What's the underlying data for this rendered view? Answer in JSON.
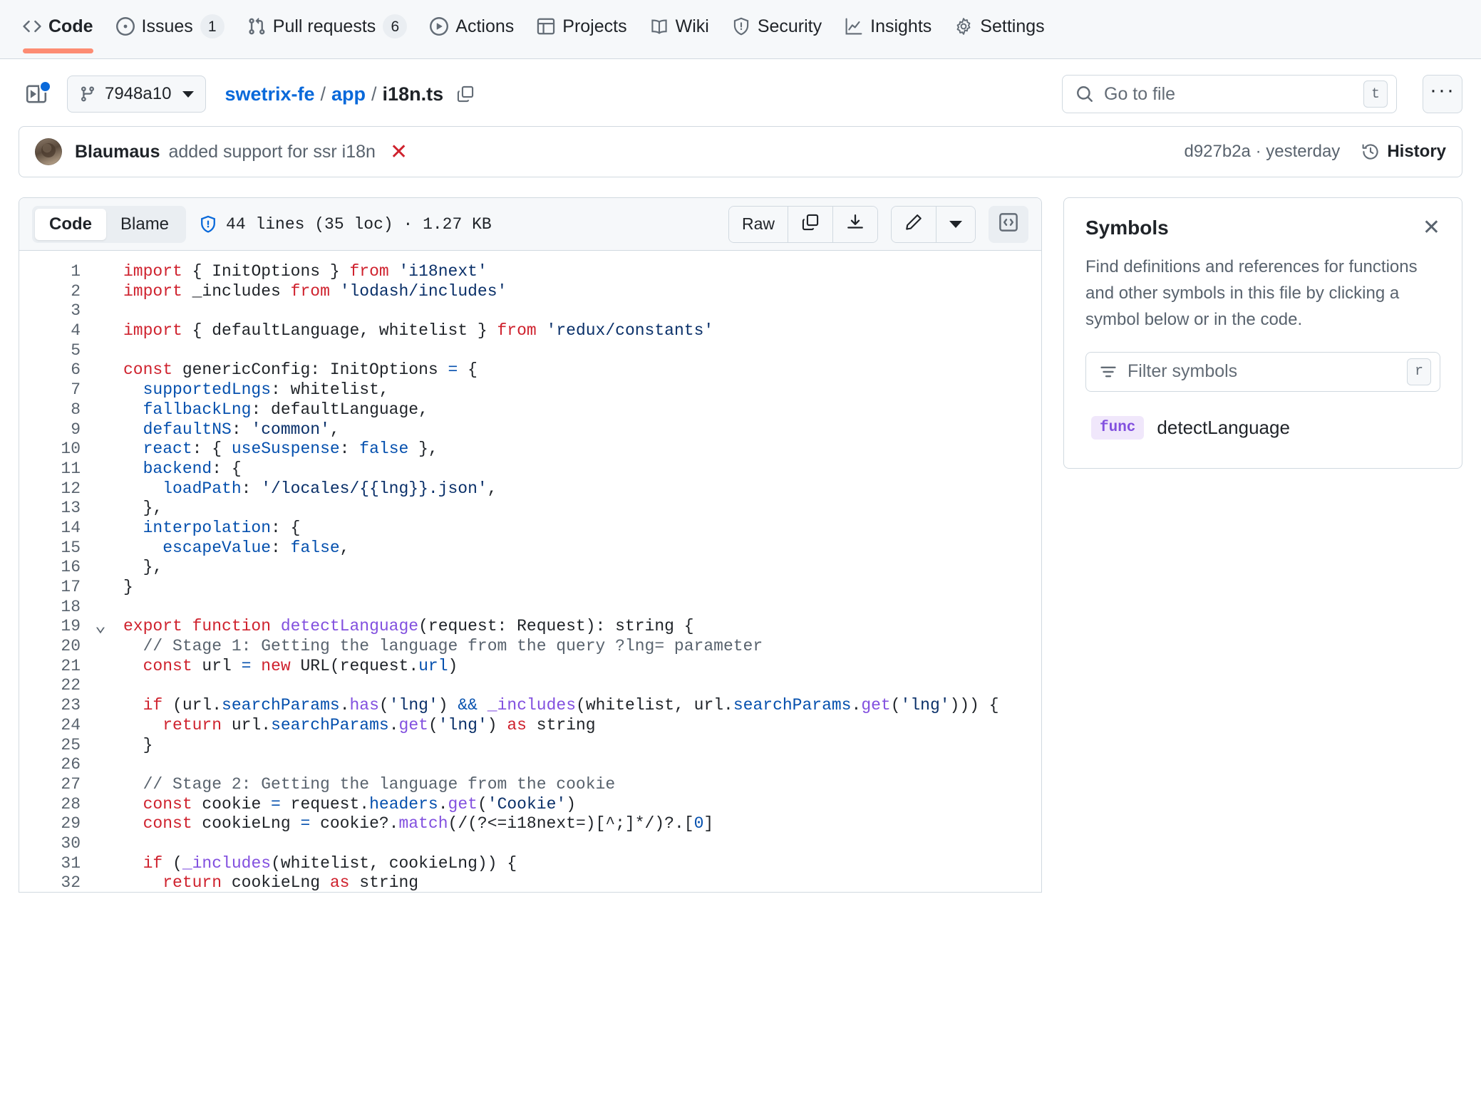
{
  "repo_nav": [
    {
      "label": "Code",
      "icon": "code-icon",
      "active": true,
      "count": null
    },
    {
      "label": "Issues",
      "icon": "issue-opened-icon",
      "active": false,
      "count": "1"
    },
    {
      "label": "Pull requests",
      "icon": "git-pull-request-icon",
      "active": false,
      "count": "6"
    },
    {
      "label": "Actions",
      "icon": "play-icon",
      "active": false,
      "count": null
    },
    {
      "label": "Projects",
      "icon": "table-icon",
      "active": false,
      "count": null
    },
    {
      "label": "Wiki",
      "icon": "book-icon",
      "active": false,
      "count": null
    },
    {
      "label": "Security",
      "icon": "shield-icon",
      "active": false,
      "count": null
    },
    {
      "label": "Insights",
      "icon": "graph-icon",
      "active": false,
      "count": null
    },
    {
      "label": "Settings",
      "icon": "gear-icon",
      "active": false,
      "count": null
    }
  ],
  "file_header": {
    "sidebar_toggle_icon": "sidebar-expand-icon",
    "branch": "7948a10",
    "branch_icon": "git-branch-icon",
    "breadcrumb": {
      "repo": "swetrix-fe",
      "sep": "/",
      "folder": "app",
      "file": "i18n.ts"
    },
    "copy_path_icon": "copy-icon",
    "search": {
      "placeholder": "Go to file",
      "icon": "search-icon",
      "kbd": "t"
    },
    "kebab_label": "···"
  },
  "commit": {
    "avatar": "avatar",
    "author": "Blaumaus",
    "message": "added support for ssr i18n",
    "status_icon": "x-icon",
    "sha": "d927b2a",
    "separator": "·",
    "time": "yesterday",
    "history_label": "History",
    "history_icon": "history-icon"
  },
  "code_toolbar": {
    "tabs": [
      {
        "label": "Code",
        "active": true
      },
      {
        "label": "Blame",
        "active": false
      }
    ],
    "shield_icon": "shield-check-icon",
    "file_stats": "44 lines (35 loc) · 1.27 KB",
    "raw_label": "Raw",
    "copy_icon": "copy-icon",
    "download_icon": "download-icon",
    "edit_icon": "pencil-icon",
    "edit_caret_icon": "chevron-down-icon",
    "symbols_toggle_icon": "code-brackets-icon"
  },
  "code_lines": [
    {
      "n": "1",
      "fold": false,
      "tokens": [
        [
          "k",
          "import"
        ],
        [
          "t",
          " { InitOptions } "
        ],
        [
          "k",
          "from"
        ],
        [
          "t",
          " "
        ],
        [
          "s",
          "'i18next'"
        ]
      ]
    },
    {
      "n": "2",
      "fold": false,
      "tokens": [
        [
          "k",
          "import"
        ],
        [
          "t",
          " _includes "
        ],
        [
          "k",
          "from"
        ],
        [
          "t",
          " "
        ],
        [
          "s",
          "'lodash/includes'"
        ]
      ]
    },
    {
      "n": "3",
      "fold": false,
      "tokens": []
    },
    {
      "n": "4",
      "fold": false,
      "tokens": [
        [
          "k",
          "import"
        ],
        [
          "t",
          " { defaultLanguage, whitelist } "
        ],
        [
          "k",
          "from"
        ],
        [
          "t",
          " "
        ],
        [
          "s",
          "'redux/constants'"
        ]
      ]
    },
    {
      "n": "5",
      "fold": false,
      "tokens": []
    },
    {
      "n": "6",
      "fold": false,
      "tokens": [
        [
          "k",
          "const"
        ],
        [
          "t",
          " genericConfig: InitOptions "
        ],
        [
          "op",
          "="
        ],
        [
          "t",
          " {"
        ]
      ]
    },
    {
      "n": "7",
      "fold": false,
      "tokens": [
        [
          "t",
          "  "
        ],
        [
          "p",
          "supportedLngs"
        ],
        [
          "t",
          ": whitelist,"
        ]
      ]
    },
    {
      "n": "8",
      "fold": false,
      "tokens": [
        [
          "t",
          "  "
        ],
        [
          "p",
          "fallbackLng"
        ],
        [
          "t",
          ": defaultLanguage,"
        ]
      ]
    },
    {
      "n": "9",
      "fold": false,
      "tokens": [
        [
          "t",
          "  "
        ],
        [
          "p",
          "defaultNS"
        ],
        [
          "t",
          ": "
        ],
        [
          "s",
          "'common'"
        ],
        [
          "t",
          ","
        ]
      ]
    },
    {
      "n": "10",
      "fold": false,
      "tokens": [
        [
          "t",
          "  "
        ],
        [
          "p",
          "react"
        ],
        [
          "t",
          ": { "
        ],
        [
          "p",
          "useSuspense"
        ],
        [
          "t",
          ": "
        ],
        [
          "p",
          "false"
        ],
        [
          "t",
          " },"
        ]
      ]
    },
    {
      "n": "11",
      "fold": false,
      "tokens": [
        [
          "t",
          "  "
        ],
        [
          "p",
          "backend"
        ],
        [
          "t",
          ": {"
        ]
      ]
    },
    {
      "n": "12",
      "fold": false,
      "tokens": [
        [
          "t",
          "    "
        ],
        [
          "p",
          "loadPath"
        ],
        [
          "t",
          ": "
        ],
        [
          "s",
          "'/locales/{{lng}}.json'"
        ],
        [
          "t",
          ","
        ]
      ]
    },
    {
      "n": "13",
      "fold": false,
      "tokens": [
        [
          "t",
          "  },"
        ]
      ]
    },
    {
      "n": "14",
      "fold": false,
      "tokens": [
        [
          "t",
          "  "
        ],
        [
          "p",
          "interpolation"
        ],
        [
          "t",
          ": {"
        ]
      ]
    },
    {
      "n": "15",
      "fold": false,
      "tokens": [
        [
          "t",
          "    "
        ],
        [
          "p",
          "escapeValue"
        ],
        [
          "t",
          ": "
        ],
        [
          "p",
          "false"
        ],
        [
          "t",
          ","
        ]
      ]
    },
    {
      "n": "16",
      "fold": false,
      "tokens": [
        [
          "t",
          "  },"
        ]
      ]
    },
    {
      "n": "17",
      "fold": false,
      "tokens": [
        [
          "t",
          "}"
        ]
      ]
    },
    {
      "n": "18",
      "fold": false,
      "tokens": []
    },
    {
      "n": "19",
      "fold": true,
      "tokens": [
        [
          "k",
          "export function"
        ],
        [
          "t",
          " "
        ],
        [
          "f",
          "detectLanguage"
        ],
        [
          "t",
          "(request: Request): string {"
        ]
      ]
    },
    {
      "n": "20",
      "fold": false,
      "tokens": [
        [
          "t",
          "  "
        ],
        [
          "c",
          "// Stage 1: Getting the language from the query ?lng= parameter"
        ]
      ]
    },
    {
      "n": "21",
      "fold": false,
      "tokens": [
        [
          "t",
          "  "
        ],
        [
          "k",
          "const"
        ],
        [
          "t",
          " url "
        ],
        [
          "op",
          "="
        ],
        [
          "t",
          " "
        ],
        [
          "k",
          "new"
        ],
        [
          "t",
          " URL(request."
        ],
        [
          "p",
          "url"
        ],
        [
          "t",
          ")"
        ]
      ]
    },
    {
      "n": "22",
      "fold": false,
      "tokens": []
    },
    {
      "n": "23",
      "fold": false,
      "tokens": [
        [
          "t",
          "  "
        ],
        [
          "k",
          "if"
        ],
        [
          "t",
          " (url."
        ],
        [
          "p",
          "searchParams"
        ],
        [
          "t",
          "."
        ],
        [
          "f",
          "has"
        ],
        [
          "t",
          "("
        ],
        [
          "s",
          "'lng'"
        ],
        [
          "t",
          ") "
        ],
        [
          "op",
          "&&"
        ],
        [
          "t",
          " "
        ],
        [
          "f",
          "_includes"
        ],
        [
          "t",
          "(whitelist, url."
        ],
        [
          "p",
          "searchParams"
        ],
        [
          "t",
          "."
        ],
        [
          "f",
          "get"
        ],
        [
          "t",
          "("
        ],
        [
          "s",
          "'lng'"
        ],
        [
          "t",
          "))) {"
        ]
      ]
    },
    {
      "n": "24",
      "fold": false,
      "tokens": [
        [
          "t",
          "    "
        ],
        [
          "k",
          "return"
        ],
        [
          "t",
          " url."
        ],
        [
          "p",
          "searchParams"
        ],
        [
          "t",
          "."
        ],
        [
          "f",
          "get"
        ],
        [
          "t",
          "("
        ],
        [
          "s",
          "'lng'"
        ],
        [
          "t",
          ") "
        ],
        [
          "k",
          "as"
        ],
        [
          "t",
          " string"
        ]
      ]
    },
    {
      "n": "25",
      "fold": false,
      "tokens": [
        [
          "t",
          "  }"
        ]
      ]
    },
    {
      "n": "26",
      "fold": false,
      "tokens": []
    },
    {
      "n": "27",
      "fold": false,
      "tokens": [
        [
          "t",
          "  "
        ],
        [
          "c",
          "// Stage 2: Getting the language from the cookie"
        ]
      ]
    },
    {
      "n": "28",
      "fold": false,
      "tokens": [
        [
          "t",
          "  "
        ],
        [
          "k",
          "const"
        ],
        [
          "t",
          " cookie "
        ],
        [
          "op",
          "="
        ],
        [
          "t",
          " request."
        ],
        [
          "p",
          "headers"
        ],
        [
          "t",
          "."
        ],
        [
          "f",
          "get"
        ],
        [
          "t",
          "("
        ],
        [
          "s",
          "'Cookie'"
        ],
        [
          "t",
          ")"
        ]
      ]
    },
    {
      "n": "29",
      "fold": false,
      "tokens": [
        [
          "t",
          "  "
        ],
        [
          "k",
          "const"
        ],
        [
          "t",
          " cookieLng "
        ],
        [
          "op",
          "="
        ],
        [
          "t",
          " cookie?."
        ],
        [
          "f",
          "match"
        ],
        [
          "t",
          "(/(?<=i18next=)[^;]*/)?.["
        ],
        [
          "n",
          "0"
        ],
        [
          "t",
          "]"
        ]
      ]
    },
    {
      "n": "30",
      "fold": false,
      "tokens": []
    },
    {
      "n": "31",
      "fold": false,
      "tokens": [
        [
          "t",
          "  "
        ],
        [
          "k",
          "if"
        ],
        [
          "t",
          " ("
        ],
        [
          "f",
          "_includes"
        ],
        [
          "t",
          "(whitelist, cookieLng)) {"
        ]
      ]
    },
    {
      "n": "32",
      "fold": false,
      "tokens": [
        [
          "t",
          "    "
        ],
        [
          "k",
          "return"
        ],
        [
          "t",
          " cookieLng "
        ],
        [
          "k",
          "as"
        ],
        [
          "t",
          " string"
        ]
      ]
    }
  ],
  "symbols": {
    "title": "Symbols",
    "close_icon": "close-icon",
    "description": "Find definitions and references for functions and other symbols in this file by clicking a symbol below or in the code.",
    "filter": {
      "placeholder": "Filter symbols",
      "icon": "filter-icon",
      "kbd": "r"
    },
    "items": [
      {
        "kind": "func",
        "name": "detectLanguage"
      }
    ]
  },
  "colors": {
    "accent": "#0969da",
    "active_tab_underline": "#fd8c73",
    "keyword": "#cf222e",
    "string": "#0a3069",
    "property": "#0550ae",
    "function": "#8250df",
    "comment": "#59636e",
    "border": "#d1d9e0",
    "surface": "#f6f8fa"
  }
}
